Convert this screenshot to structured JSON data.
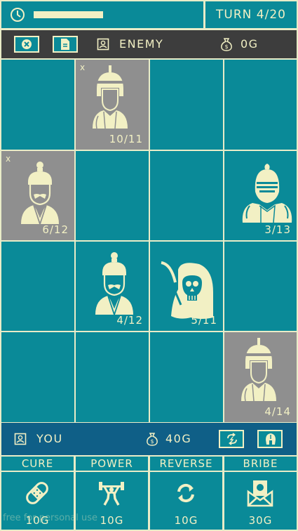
{
  "colors": {
    "teal": "#0a8a98",
    "cream": "#f2f0c4",
    "dark": "#3d3d3d",
    "navy": "#0f5f87",
    "gray": "#8f8f8f"
  },
  "topbar": {
    "clock_icon": "clock-icon",
    "timer_fraction": 0.72,
    "turn_label": "TURN 4/20"
  },
  "enemy": {
    "cancel_icon": "close-circle-icon",
    "doc_icon": "document-icon",
    "player_icon": "portrait-icon",
    "name": "ENEMY",
    "gold_icon": "money-bag-icon",
    "gold": "0G"
  },
  "board": {
    "rows": 4,
    "cols": 4,
    "units": [
      {
        "row": 0,
        "col": 1,
        "type": "gladiator",
        "hp": "10/11",
        "owner": "enemy",
        "mark": "x"
      },
      {
        "row": 1,
        "col": 0,
        "type": "samurai",
        "hp": "6/12",
        "owner": "enemy",
        "mark": "x"
      },
      {
        "row": 1,
        "col": 3,
        "type": "knight",
        "hp": "3/13",
        "owner": "player",
        "mark": ""
      },
      {
        "row": 2,
        "col": 1,
        "type": "samurai",
        "hp": "4/12",
        "owner": "player",
        "mark": ""
      },
      {
        "row": 2,
        "col": 2,
        "type": "reaper",
        "hp": "5/11",
        "owner": "player",
        "mark": ""
      },
      {
        "row": 3,
        "col": 3,
        "type": "gladiator",
        "hp": "4/14",
        "owner": "enemy",
        "mark": ""
      }
    ]
  },
  "you": {
    "player_icon": "portrait-icon",
    "name": "YOU",
    "gold_icon": "money-bag-icon",
    "gold": "40G",
    "swap_icon": "swap-icon",
    "helmet_icon": "helmet-icon"
  },
  "actions": [
    {
      "label": "CURE",
      "icon": "bandage-icon",
      "cost": "10G"
    },
    {
      "label": "POWER",
      "icon": "weightlifter-icon",
      "cost": "10G"
    },
    {
      "label": "REVERSE",
      "icon": "refresh-icon",
      "cost": "10G"
    },
    {
      "label": "BRIBE",
      "icon": "money-envelope-icon",
      "cost": "30G"
    }
  ],
  "watermark": "free for personal use"
}
